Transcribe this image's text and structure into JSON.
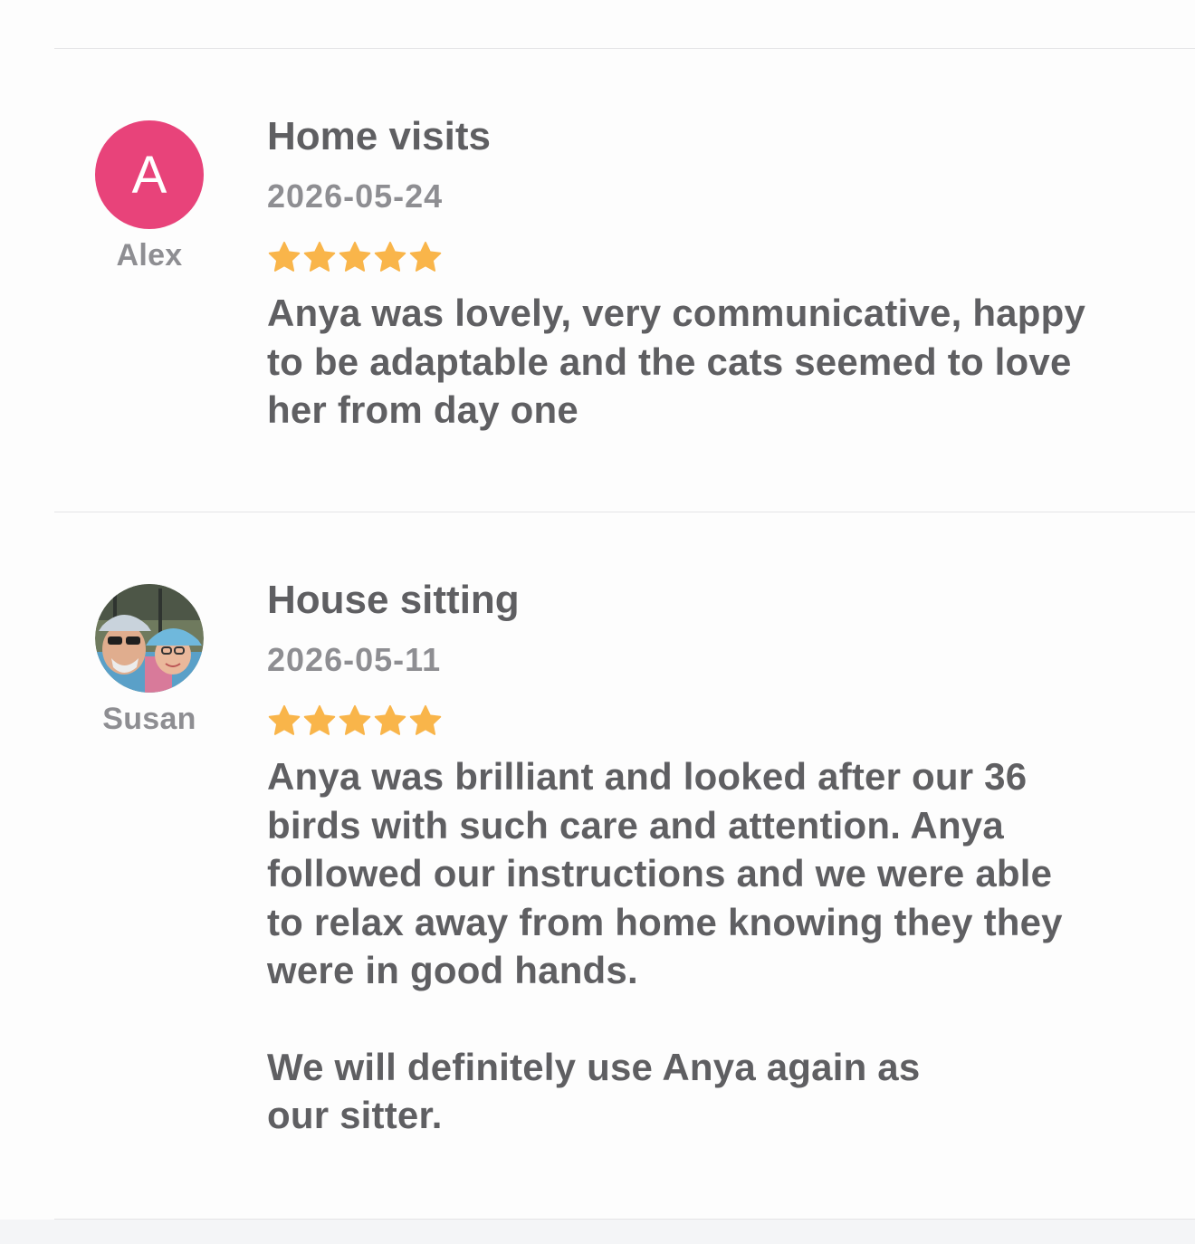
{
  "reviews": [
    {
      "reviewer": "Alex",
      "avatar_letter": "A",
      "avatar_color": "#e8437a",
      "service": "Home visits",
      "date": "2026-05-24",
      "rating": 5,
      "rating_max": 5,
      "text": "Anya was lovely, very communicative, happy\nto be adaptable and the cats seemed to love\nher from day one"
    },
    {
      "reviewer": "Susan",
      "avatar_icon": "user-photo",
      "service": "House sitting",
      "date": "2026-05-11",
      "rating": 5,
      "rating_max": 5,
      "text": "Anya was brilliant and looked after our 36\nbirds with such care and attention. Anya\nfollowed our instructions and we were able\nto relax away from home knowing they they\nwere in good hands.",
      "text_2": "We will definitely use Anya again as\nour sitter."
    }
  ],
  "colors": {
    "star": "#f9b54a",
    "text": "#5f5f62",
    "muted": "#8e8e92",
    "divider": "#e4e4e6"
  }
}
